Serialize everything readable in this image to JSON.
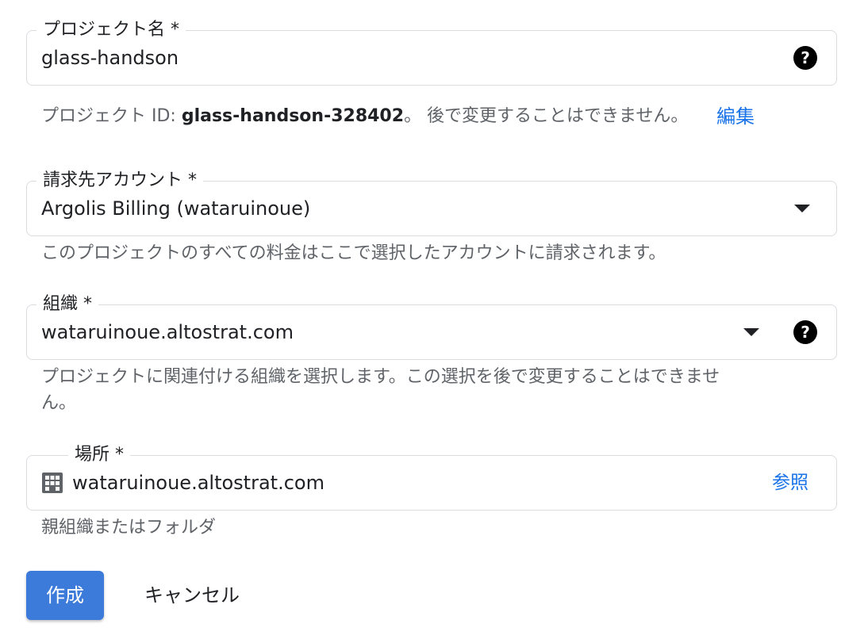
{
  "project_name": {
    "label": "プロジェクト名 *",
    "value": "glass-handson",
    "help_prefix": "プロジェクト ID: ",
    "project_id": "glass-handson-328402",
    "help_suffix": "。 後で変更することはできません。",
    "edit_link": "編集"
  },
  "billing": {
    "label": "請求先アカウント *",
    "value": "Argolis Billing (wataruinoue)",
    "help": "このプロジェクトのすべての料金はここで選択したアカウントに請求されます。"
  },
  "organization": {
    "label": "組織 *",
    "value": "wataruinoue.altostrat.com",
    "help_line1": "プロジェクトに関連付ける組織を選択します。この選択を後で変更することはできませ",
    "help_line2": "ん。"
  },
  "location": {
    "label": "場所 *",
    "value": "wataruinoue.altostrat.com",
    "browse_link": "参照",
    "help": "親組織またはフォルダ"
  },
  "actions": {
    "create_label": "作成",
    "cancel_label": "キャンセル"
  },
  "icons": {
    "help": "help-circle-icon",
    "dropdown": "arrow-drop-down-icon",
    "domain": "building-icon"
  },
  "colors": {
    "accent": "#1a73e8",
    "primary_button": "#3c7bd9",
    "border": "#dadce0",
    "help_text": "#5f6368"
  }
}
